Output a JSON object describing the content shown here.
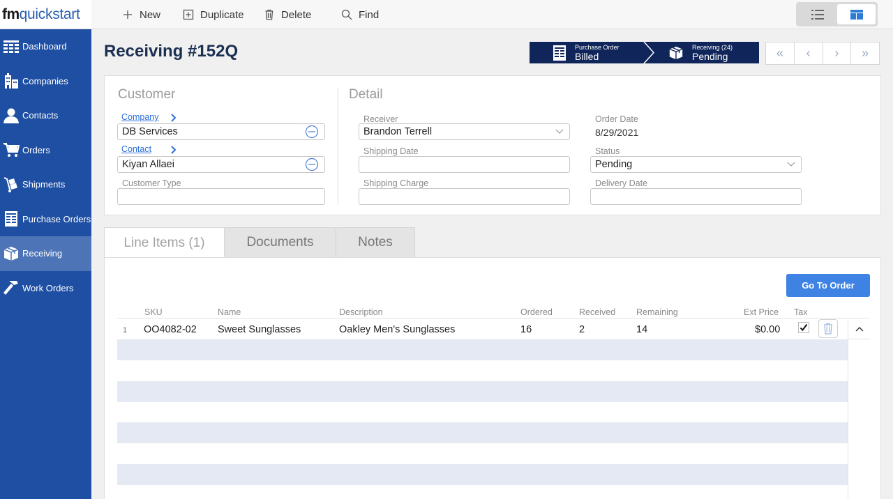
{
  "app": {
    "logo_fm": "fm",
    "logo_rest": "quickstart"
  },
  "sidebar": {
    "items": [
      {
        "label": "Dashboard",
        "icon": "dashboard-grid-icon",
        "active": false
      },
      {
        "label": "Companies",
        "icon": "buildings-icon",
        "active": false
      },
      {
        "label": "Contacts",
        "icon": "person-icon",
        "active": false
      },
      {
        "label": "Orders",
        "icon": "cart-icon",
        "active": false
      },
      {
        "label": "Shipments",
        "icon": "hand-truck-icon",
        "active": false
      },
      {
        "label": "Purchase Orders",
        "icon": "ledger-icon",
        "active": false
      },
      {
        "label": "Receiving",
        "icon": "box-icon",
        "active": true
      },
      {
        "label": "Work Orders",
        "icon": "hammer-icon",
        "active": false
      }
    ]
  },
  "toolbar": {
    "new_label": "New",
    "duplicate_label": "Duplicate",
    "delete_label": "Delete",
    "find_label": "Find"
  },
  "header": {
    "title": "Receiving #152Q"
  },
  "status_chain": {
    "step1_caption": "Purchase Order",
    "step1_value": "Billed",
    "step2_caption": "Receiving (24)",
    "step2_value": "Pending"
  },
  "pager": {
    "first": "«",
    "prev": "‹",
    "next": "›",
    "last": "»"
  },
  "customer": {
    "section_title": "Customer",
    "company_label": "Company",
    "company_value": "DB Services",
    "contact_label": "Contact",
    "contact_value": "Kiyan Allaei",
    "customer_type_label": "Customer Type",
    "customer_type_value": ""
  },
  "detail": {
    "section_title": "Detail",
    "receiver_label": "Receiver",
    "receiver_value": "Brandon Terrell",
    "shipping_date_label": "Shipping Date",
    "shipping_date_value": "",
    "shipping_charge_label": "Shipping Charge",
    "shipping_charge_value": "",
    "order_date_label": "Order Date",
    "order_date_value": "8/29/2021",
    "status_label": "Status",
    "status_value": "Pending",
    "delivery_date_label": "Delivery Date",
    "delivery_date_value": ""
  },
  "tabs": [
    {
      "label": "Line Items (1)",
      "active": true
    },
    {
      "label": "Documents",
      "active": false
    },
    {
      "label": "Notes",
      "active": false
    }
  ],
  "line_items": {
    "go_to_order_label": "Go To Order",
    "columns": {
      "sku": "SKU",
      "name": "Name",
      "description": "Description",
      "ordered": "Ordered",
      "received": "Received",
      "remaining": "Remaining",
      "ext_price": "Ext Price",
      "tax": "Tax"
    },
    "rows": [
      {
        "num": "1",
        "sku": "OO4082-02",
        "name": "Sweet Sunglasses",
        "description": "Oakley Men's Sunglasses",
        "ordered": "16",
        "received": "2",
        "remaining": "14",
        "ext_price": "$0.00",
        "tax_checked": true
      }
    ]
  },
  "colors": {
    "sidebar_bg": "#1f4fa3",
    "sidebar_active": "#4d74b6",
    "status_chain_bg": "#10255a",
    "accent_button": "#3e82e4",
    "title_color": "#1b2f52",
    "stripe": "#e4e9f3"
  }
}
